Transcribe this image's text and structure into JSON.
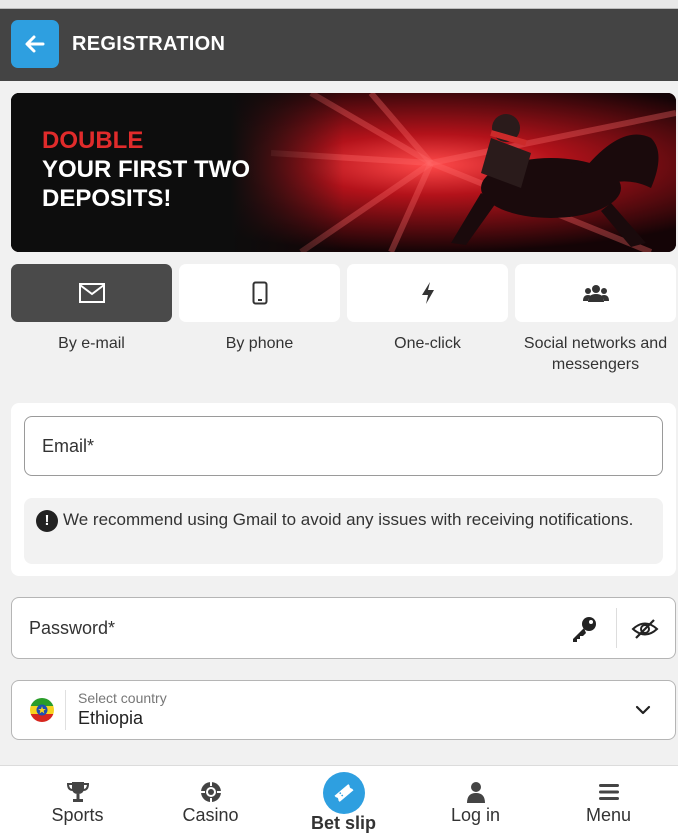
{
  "header": {
    "title": "REGISTRATION",
    "back_icon": "arrow-left-icon"
  },
  "banner": {
    "line1": "DOUBLE",
    "line2": "YOUR FIRST TWO",
    "line3": "DEPOSITS!",
    "accent_color": "#e02b2b"
  },
  "tabs": [
    {
      "label": "By e-mail",
      "icon": "envelope-icon",
      "active": true
    },
    {
      "label": "By phone",
      "icon": "phone-icon",
      "active": false
    },
    {
      "label": "One-click",
      "icon": "lightning-icon",
      "active": false
    },
    {
      "label": "Social networks and messengers",
      "icon": "users-icon",
      "active": false
    }
  ],
  "form": {
    "email_placeholder": "Email*",
    "notice": "We recommend using Gmail to avoid any issues with receiving notifications.",
    "password_placeholder": "Password*",
    "country_caption": "Select country",
    "country_value": "Ethiopia"
  },
  "bottom_nav": {
    "sports": "Sports",
    "casino": "Casino",
    "betslip": "Bet slip",
    "login": "Log in",
    "menu": "Menu"
  },
  "colors": {
    "header_bg": "#444444",
    "accent_blue": "#2e9fe0",
    "active_tab": "#4a4a4a"
  }
}
